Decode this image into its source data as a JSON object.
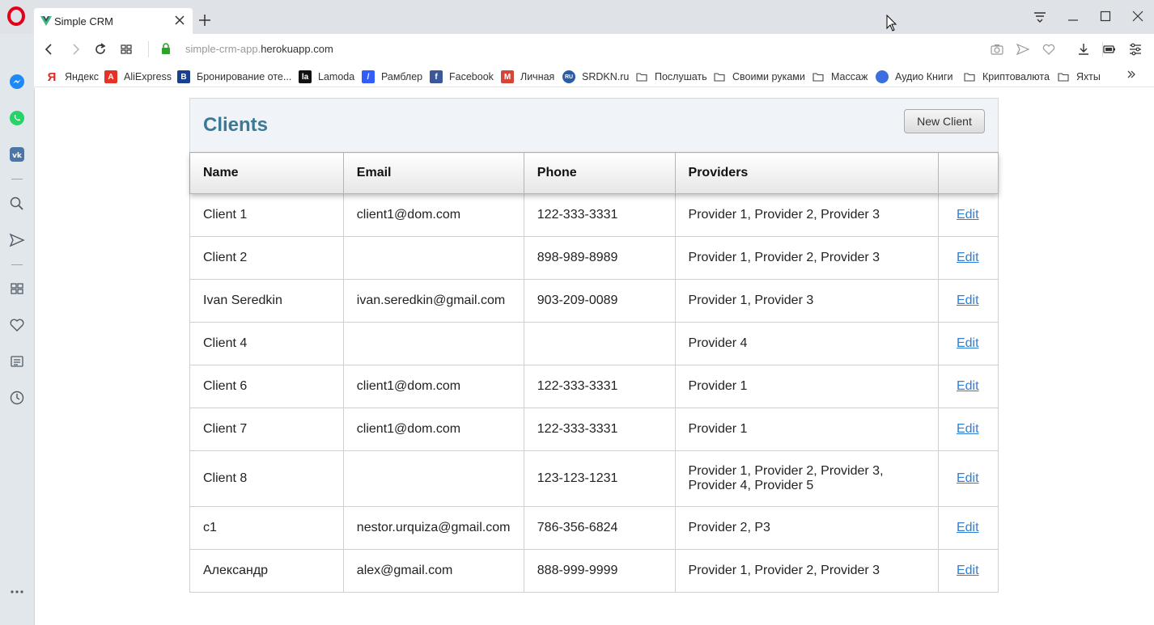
{
  "browser": {
    "tab_title": "Simple CRM",
    "url_host_prefix": "simple-crm-app.",
    "url_host_domain": "herokuapp.com",
    "bookmarks": [
      {
        "label": "Яндекс",
        "icon": "yandex-icon",
        "color": "#e52620",
        "glyph": "Я"
      },
      {
        "label": "AliExpress",
        "icon": "aliexpress-icon",
        "color": "#e43225",
        "glyph": "A"
      },
      {
        "label": "Бронирование оте...",
        "icon": "booking-icon",
        "color": "#1a3f8f",
        "glyph": "B"
      },
      {
        "label": "Lamoda",
        "icon": "lamoda-icon",
        "color": "#111111",
        "glyph": "la"
      },
      {
        "label": "Рамблер",
        "icon": "rambler-icon",
        "color": "#315efb",
        "glyph": "/"
      },
      {
        "label": "Facebook",
        "icon": "facebook-icon",
        "color": "#3b5998",
        "glyph": "f"
      },
      {
        "label": "Личная",
        "icon": "gmail-icon",
        "color": "#d44638",
        "glyph": "M"
      },
      {
        "label": "SRDKN.ru",
        "icon": "srdkn-icon",
        "color": "#2a5caa",
        "glyph": "RU"
      },
      {
        "label": "Послушать",
        "icon": "folder-icon",
        "color": "",
        "glyph": ""
      },
      {
        "label": "Своими руками",
        "icon": "folder-icon",
        "color": "",
        "glyph": ""
      },
      {
        "label": "Массаж",
        "icon": "folder-icon",
        "color": "",
        "glyph": ""
      },
      {
        "label": "Аудио Книги",
        "icon": "audiobooks-icon",
        "color": "#3b6fe0",
        "glyph": ""
      },
      {
        "label": "Криптовалюта",
        "icon": "folder-icon",
        "color": "",
        "glyph": ""
      },
      {
        "label": "Яхты",
        "icon": "folder-icon",
        "color": "",
        "glyph": ""
      }
    ]
  },
  "app": {
    "title": "Clients",
    "new_client_label": "New Client",
    "accent_color": "#3b7a96",
    "link_color": "#2f7fd6",
    "columns": [
      "Name",
      "Email",
      "Phone",
      "Providers",
      ""
    ],
    "rows": [
      {
        "name": "Client 1",
        "email": "client1@dom.com",
        "phone": "122-333-3331",
        "providers": "Provider 1, Provider 2, Provider 3",
        "action": "Edit"
      },
      {
        "name": "Client 2",
        "email": "",
        "phone": "898-989-8989",
        "providers": "Provider 1, Provider 2, Provider 3",
        "action": "Edit"
      },
      {
        "name": "Ivan Seredkin",
        "email": "ivan.seredkin@gmail.com",
        "phone": "903-209-0089",
        "providers": "Provider 1, Provider 3",
        "action": "Edit"
      },
      {
        "name": "Client 4",
        "email": "",
        "phone": "",
        "providers": "Provider 4",
        "action": "Edit"
      },
      {
        "name": "Client 6",
        "email": "client1@dom.com",
        "phone": "122-333-3331",
        "providers": "Provider 1",
        "action": "Edit"
      },
      {
        "name": "Client 7",
        "email": "client1@dom.com",
        "phone": "122-333-3331",
        "providers": "Provider 1",
        "action": "Edit"
      },
      {
        "name": "Client 8",
        "email": "",
        "phone": "123-123-1231",
        "providers": "Provider 1, Provider 2, Provider 3, Provider 4, Provider 5",
        "action": "Edit"
      },
      {
        "name": "c1",
        "email": "nestor.urquiza@gmail.com",
        "phone": "786-356-6824",
        "providers": "Provider 2, P3",
        "action": "Edit"
      },
      {
        "name": "Александр",
        "email": "alex@gmail.com",
        "phone": "888-999-9999",
        "providers": "Provider 1, Provider 2, Provider 3",
        "action": "Edit"
      }
    ]
  }
}
